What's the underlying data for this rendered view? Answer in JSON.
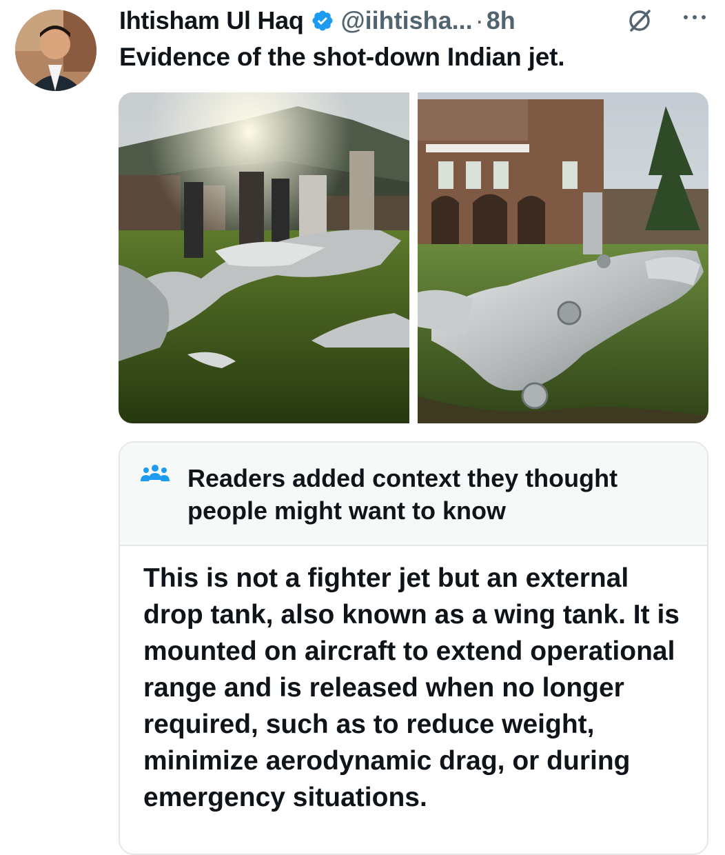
{
  "post": {
    "author_name": "Ihtisham Ul Haq",
    "handle": "@iihtisha...",
    "separator": "·",
    "time": "8h",
    "text": "Evidence of the shot-down Indian jet.",
    "icons": {
      "verified": "verified-badge-icon",
      "grok": "grok-icon",
      "more": "more-options-icon"
    },
    "colors": {
      "verified": "#1d9bf0",
      "secondary_text": "#536471"
    }
  },
  "community_note": {
    "title": "Readers added context they thought people might want to know",
    "icon": "people-icon",
    "body": "This is not a fighter jet but an external drop tank, also known as a wing tank. It is mounted on aircraft to extend operational range and is released when no longer required, such as to reduce weight, minimize aerodynamic drag, or during emergency situations.",
    "colors": {
      "icon": "#1d9bf0",
      "header_bg": "#f7f9f9",
      "border": "#e3e7ea"
    }
  }
}
